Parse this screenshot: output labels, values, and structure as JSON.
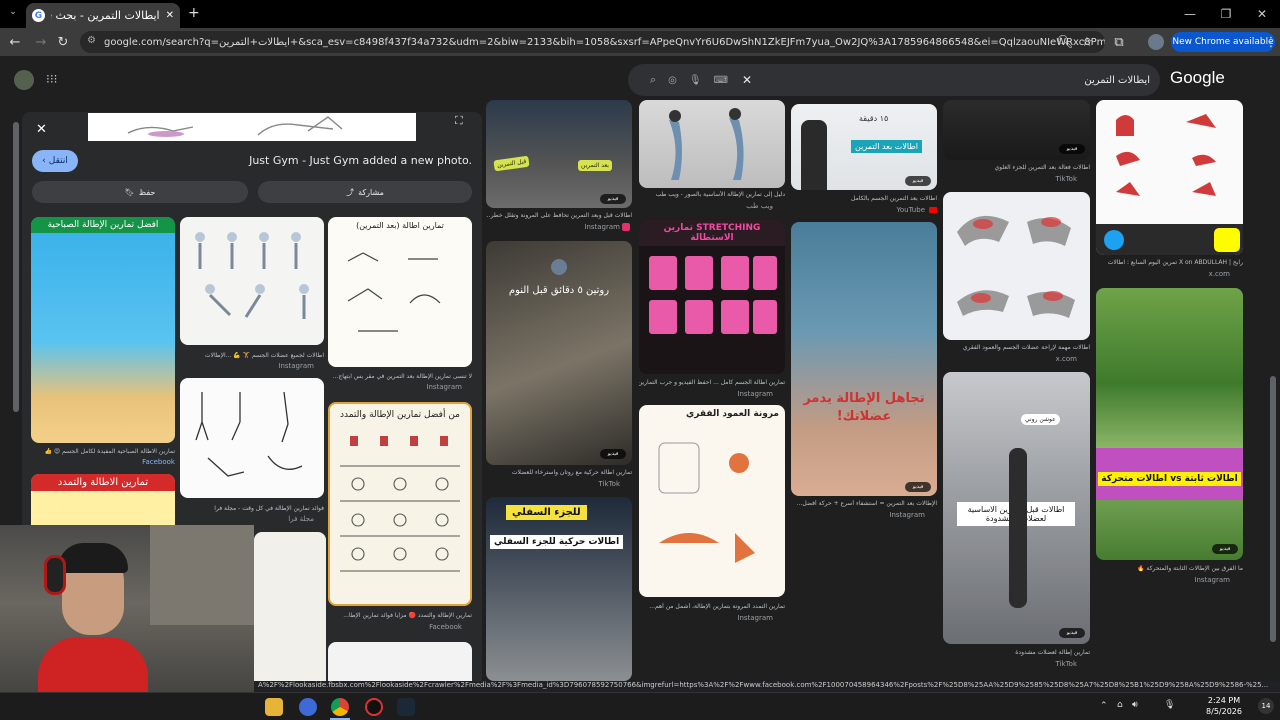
{
  "browser": {
    "tab_title": "ایطالات التمرين - بحث Google",
    "url": "google.com/search?q=ايطالات+التمرين+&sca_esv=c8498f437f34a732&udm=2&biw=2133&bih=1058&sxsrf=APpeQnvYr6U6DwShN1ZkEJFm7yua_Ow2JQ%3A1785964866548&ei=QqlzaouNIeWRxc8PmP7V2A8&ved=0ahUKEwiLt...",
    "new_chrome_label": "New Chrome available"
  },
  "google": {
    "logo": "Google",
    "query": "ايطالات التمرين"
  },
  "panel": {
    "visit_label": "انتقل",
    "post_title": "Just Gym - Just Gym added a new photo.",
    "share_label": "مشاركة",
    "save_label": "حفظ",
    "thumbs": [
      {
        "heading": "افضل تمارين الإطالة الصباحية",
        "caption": "تمارين الاطالة الصباحية المفيدة لكامل الجسم 😍 👍",
        "source": "Facebook"
      },
      {
        "caption": "اطالات لجميع عضلات الجسم 🏋️ 💪 ...الإطالات",
        "source": "Instagram"
      },
      {
        "heading": "تمارين اطالة (بعد التمرين)",
        "caption": "لا تنسى تمارين الإطالة بعد التمرين في مقر بس ابتهاج...",
        "source": "Instagram"
      },
      {
        "heading": "تمارين الاطالة والتمدد"
      },
      {
        "caption": "فوائد تمارين الإطالة في كل وقت - مجلة فرا",
        "source": "مجلة فرا"
      },
      {
        "heading": "من أفضل تمارين الإطالة والتمدد",
        "caption": "تمارين الإطالة والتمدد 🔴 مزايا فوائد تمارين الإطا...",
        "source": "Facebook"
      }
    ]
  },
  "results": [
    {
      "caption": "اطالات قبل وبعد التمرين تحافظ على المرونة وتقلل خطر...",
      "source": "Instagram",
      "overlay": "بعد التمرين"
    },
    {
      "caption": "دليل إلى تمارين الإطالة الأساسية بالصور - ويب طب",
      "source": "ويب طب"
    },
    {
      "caption": "اطالات بعد التمرين الجسم بالكامل",
      "source": "YouTube",
      "overlay": "اطالات بعد التمرين",
      "sub": "١٥ دقيقة"
    },
    {
      "caption": "اطالات فعالة بعد التمرين للجزء العلوي",
      "source": "TikTok"
    },
    {
      "caption": "رابح | X on ABDULLAH تمرين اليوم السابع : اطالات",
      "source": "x.com"
    },
    {
      "caption": "تمارين اطالة حركية مع روتان واسترخاء للعضلات",
      "source": "TikTok",
      "overlay": "روتين ٥ دقائق قبل النوم"
    },
    {
      "caption": "تمارين اطالة الجسم كامل ... احفظ الفيديو و جرب التمارين",
      "source": "Instagram",
      "overlay": "STRETCHING تمارين الاستطالة"
    },
    {
      "caption": "الإطالات بعد التمرين = استشفاء أسرع + حركة أفضل...",
      "source": "Instagram",
      "overlay": "تجاهل الإطالة يدمر عضلاتك!"
    },
    {
      "caption": "اطالات مهمة لإراحة عضلات الجسم والعمود الفقري",
      "source": "x.com"
    },
    {
      "caption": "ما الفرق بين الإطالات الثابتة والمتحركة 🔥",
      "source": "Instagram",
      "overlay": "اطالات ثابتة vs اطالات متحركة"
    },
    {
      "caption": "",
      "source": "",
      "overlay": "اطالات حركية للجزء السفلي"
    },
    {
      "caption": "تمارين التمدد المرونة بتمارين الإطالة، أشمل من أهم...",
      "source": "Instagram",
      "overlay": "مرونة العمود الفقري"
    },
    {
      "caption": "تمارين إطالة لعضلات مشدودة",
      "source": "TikTok",
      "overlay": "اطالات قبل التمرين الاساسية لعضلات المشدودة",
      "sub": "عوشن روني"
    }
  ],
  "status_url": "A%2F%2Flookaside.fbsbx.com%2Flookaside%2Fcrawler%2Fmedia%2F%3Fmedia_id%3D796078592750766&imgrefurl=https%3A%2F%2Fwww.facebook.com%2F100070458964346%2Fposts%2F%25D8%25AA%25D9%2585%25D8%25A7%25D8%25B1%25D9%258A%25D9%2586-%25...",
  "clock": {
    "time": "2:24 PM",
    "date": "8/5/2026"
  },
  "video_badge": "فيديو",
  "colors": {
    "accent": "#8ab4f8",
    "instagram": "#e1306c",
    "youtube": "#ff0000",
    "chrome_blue": "#0b57d0"
  }
}
